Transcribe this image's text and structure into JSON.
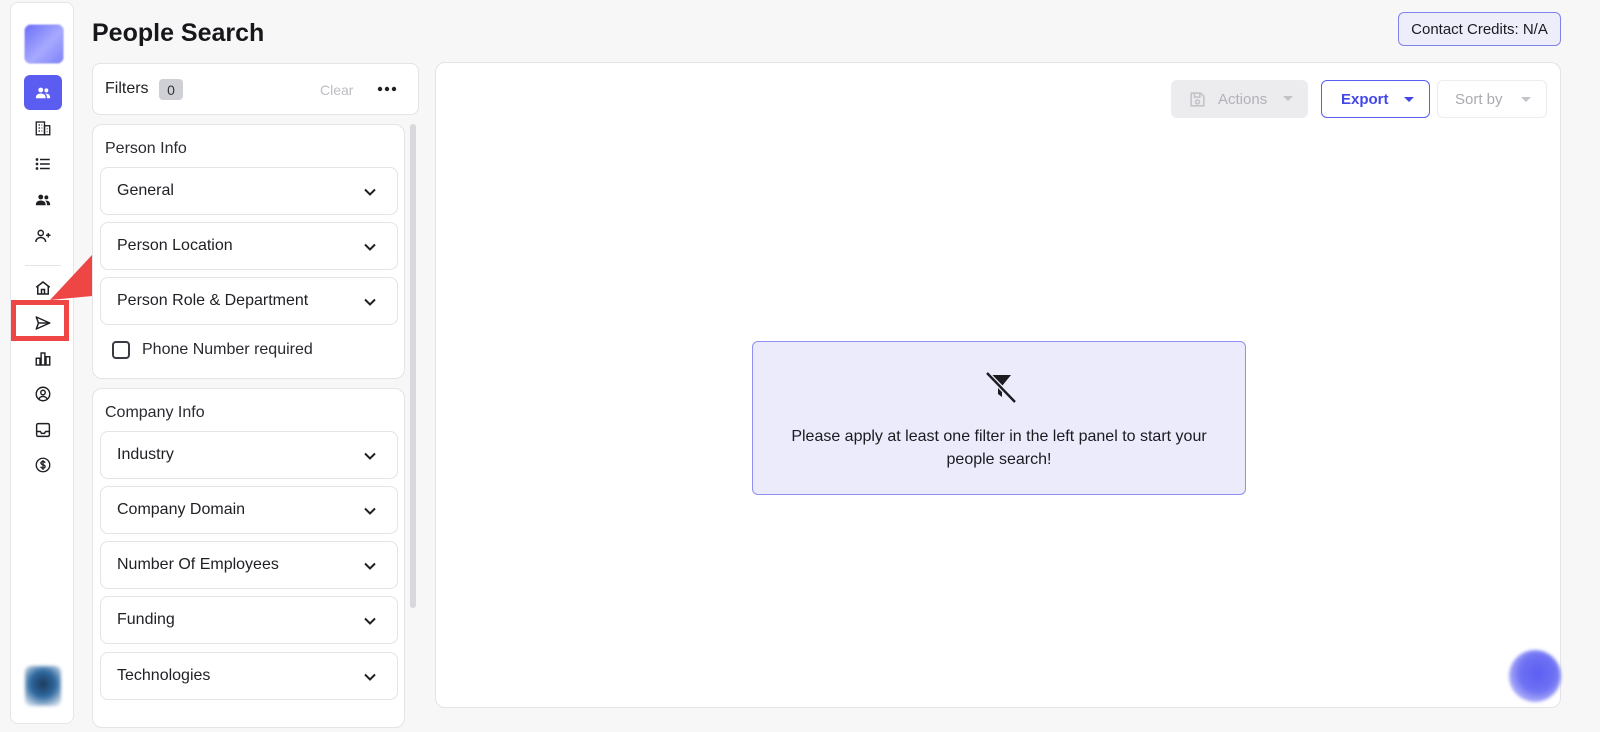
{
  "header": {
    "title": "People Search",
    "credits": "Contact Credits: N/A"
  },
  "rail": {
    "items": [
      {
        "name": "people-icon",
        "active": true
      },
      {
        "name": "building-icon",
        "active": false
      },
      {
        "name": "list-icon",
        "active": false
      },
      {
        "name": "contacts-icon",
        "active": false
      },
      {
        "name": "add-person-icon",
        "active": false
      },
      {
        "name": "home-icon",
        "active": false
      },
      {
        "name": "send-icon",
        "active": false
      },
      {
        "name": "bar-chart-icon",
        "active": false
      },
      {
        "name": "user-circle-icon",
        "active": false
      },
      {
        "name": "inbox-icon",
        "active": false
      },
      {
        "name": "dollar-icon",
        "active": false
      }
    ]
  },
  "filters": {
    "label": "Filters",
    "count": "0",
    "clear": "Clear"
  },
  "person_info": {
    "title": "Person Info",
    "items": [
      "General",
      "Person Location",
      "Person Role & Department"
    ],
    "checkbox_label": "Phone Number required"
  },
  "company_info": {
    "title": "Company Info",
    "items": [
      "Industry",
      "Company Domain",
      "Number Of Employees",
      "Funding",
      "Technologies"
    ]
  },
  "toolbar": {
    "actions": "Actions",
    "export": "Export",
    "sort": "Sort by"
  },
  "empty_state": {
    "message": "Please apply at least one filter in the left panel to start your people search!"
  },
  "colors": {
    "accent": "#5a5df0",
    "highlight": "#ee4545",
    "empty_card_bg": "#ebebfb"
  }
}
